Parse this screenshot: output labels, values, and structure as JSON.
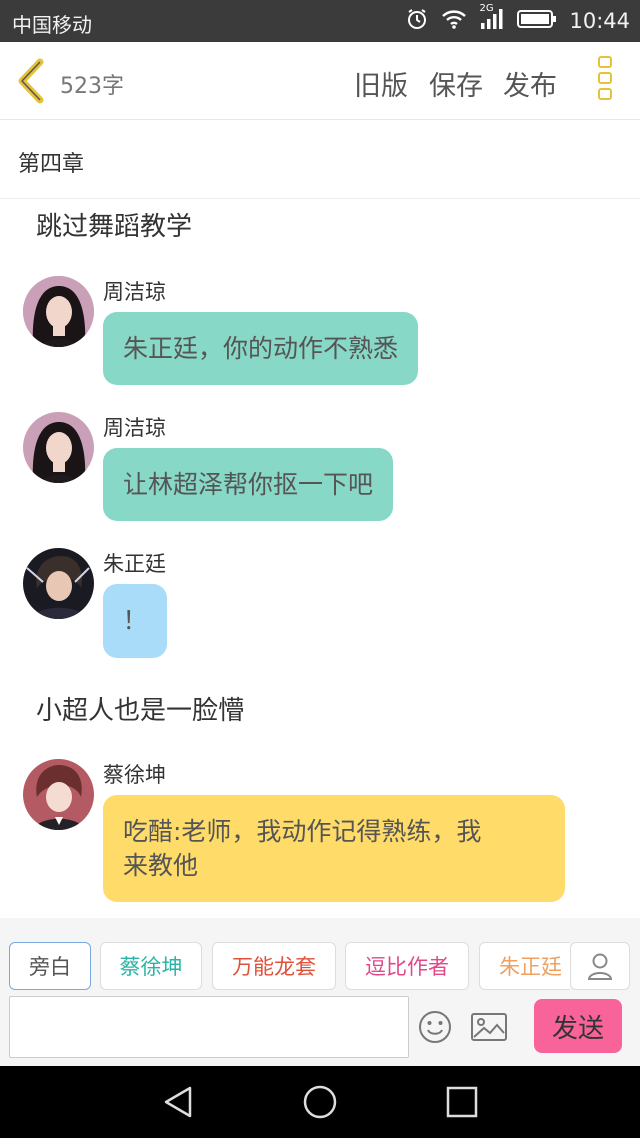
{
  "status_bar": {
    "carrier": "中国移动",
    "network": "2G",
    "time": "10:44"
  },
  "header": {
    "word_count": "523字",
    "old_version": "旧版",
    "save": "保存",
    "publish": "发布",
    "accent_color": "#e6c23a"
  },
  "chapter": {
    "title": "第四章"
  },
  "feed": {
    "narration_1": "跳过舞蹈教学",
    "msg_1": {
      "sender": "周洁琼",
      "text": "朱正廷，你的动作不熟悉",
      "bubble_color": "#88d8c8"
    },
    "msg_2": {
      "sender": "周洁琼",
      "text": "让林超泽帮你抠一下吧",
      "bubble_color": "#88d8c8"
    },
    "msg_3": {
      "sender": "朱正廷",
      "text": "！",
      "bubble_color": "#a8dcf8"
    },
    "narration_2": "小超人也是一脸懵",
    "msg_4": {
      "sender": "蔡徐坤",
      "text_line_1": "吃醋:老师，我动作记得熟练，我",
      "text_line_2": "来教他",
      "bubble_color": "#ffdb6a"
    }
  },
  "roles": {
    "items": [
      {
        "label": "旁白",
        "color": "#555555"
      },
      {
        "label": "蔡徐坤",
        "color": "#2bb3a8"
      },
      {
        "label": "万能龙套",
        "color": "#e0503a"
      },
      {
        "label": "逗比作者",
        "color": "#e0488a"
      },
      {
        "label": "朱正廷",
        "color": "#f0a060"
      }
    ]
  },
  "composer": {
    "input_value": "",
    "send_label": "发送",
    "send_color": "#f8649a"
  }
}
